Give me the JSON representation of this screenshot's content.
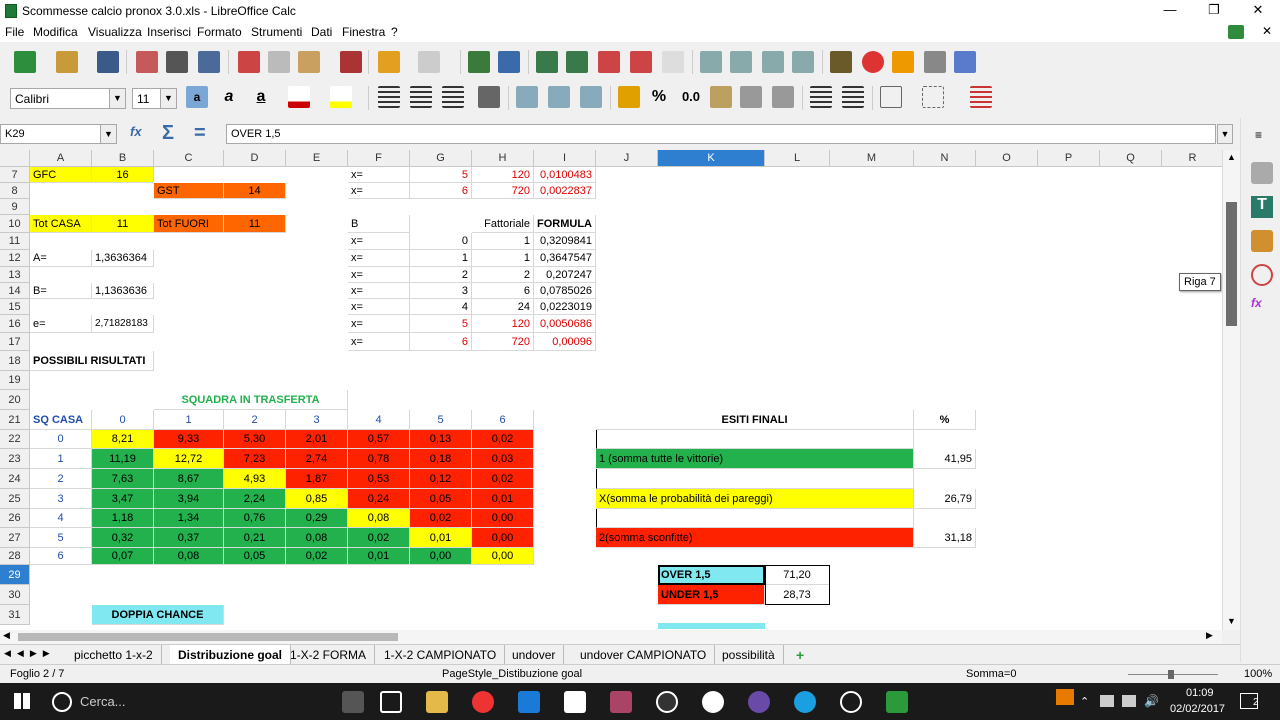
{
  "window": {
    "title": "Scommesse calcio pronox 3.0.xls - LibreOffice Calc"
  },
  "menu": [
    "File",
    "Modifica",
    "Visualizza",
    "Inserisci",
    "Formato",
    "Strumenti",
    "Dati",
    "Finestra",
    "?"
  ],
  "toolbar": {
    "font_name": "Calibri",
    "font_size": "11"
  },
  "formula_bar": {
    "name_box": "K29",
    "content": "OVER 1,5"
  },
  "columns": [
    "A",
    "B",
    "C",
    "D",
    "E",
    "F",
    "G",
    "H",
    "I",
    "J",
    "K",
    "L",
    "M",
    "N",
    "O",
    "P",
    "Q",
    "R"
  ],
  "selected_column": "K",
  "rows": [
    "7",
    "8",
    "9",
    "10",
    "11",
    "12",
    "13",
    "14",
    "15",
    "16",
    "17",
    "18",
    "19",
    "20",
    "21",
    "22",
    "23",
    "24",
    "25",
    "26",
    "27",
    "28",
    "29",
    "30",
    "31"
  ],
  "selected_row": "29",
  "cells": {
    "A7": "GFC",
    "B7": "16",
    "F7": "x=",
    "G7": "5",
    "H7": "120",
    "I7": "0,0100483",
    "C8": "GST",
    "D8": "14",
    "F8": "x=",
    "G8": "6",
    "H8": "720",
    "I8": "0,0022837",
    "A10": "Tot CASA",
    "B10": "11",
    "C10": "Tot FUORI",
    "D10": "11",
    "F10": "B",
    "H10": "Fattoriale",
    "I10": "FORMULA",
    "F11": "x=",
    "G11": "0",
    "H11": "1",
    "I11": "0,3209841",
    "A12": "A=",
    "B12": "1,3636364",
    "F12": "x=",
    "G12": "1",
    "H12": "1",
    "I12": "0,3647547",
    "F13": "x=",
    "G13": "2",
    "H13": "2",
    "I13": "0,207247",
    "A14": "B=",
    "B14": "1,1363636",
    "F14": "x=",
    "G14": "3",
    "H14": "6",
    "I14": "0,0785026",
    "F15": "x=",
    "G15": "4",
    "H15": "24",
    "I15": "0,0223019",
    "A16": "e=",
    "B16": "2,71828183",
    "F16": "x=",
    "G16": "5",
    "H16": "120",
    "I16": "0,0050686",
    "F17": "x=",
    "G17": "6",
    "H17": "720",
    "I17": "0,00096",
    "A18": "POSSIBILI RISULTATI",
    "C20": "SQUADRA IN TRASFERTA",
    "A21": "SQ CASA",
    "B21": "0",
    "C21": "1",
    "D21": "2",
    "E21": "3",
    "F21": "4",
    "G21": "5",
    "H21": "6",
    "K21": "ESITI FINALI",
    "N21": "%",
    "A22": "0",
    "B22": "8,21",
    "C22": "9,33",
    "D22": "5,30",
    "E22": "2,01",
    "F22": "0,57",
    "G22": "0,13",
    "H22": "0,02",
    "A23": "1",
    "B23": "11,19",
    "C23": "12,72",
    "D23": "7,23",
    "E23": "2,74",
    "F23": "0,78",
    "G23": "0,18",
    "H23": "0,03",
    "J23": "1 (somma tutte le vittorie)",
    "N23": "41,95",
    "A24": "2",
    "B24": "7,63",
    "C24": "8,67",
    "D24": "4,93",
    "E24": "1,87",
    "F24": "0,53",
    "G24": "0,12",
    "H24": "0,02",
    "A25": "3",
    "B25": "3,47",
    "C25": "3,94",
    "D25": "2,24",
    "E25": "0,85",
    "F25": "0,24",
    "G25": "0,05",
    "H25": "0,01",
    "J25": "X(somma le probabilità dei pareggi)",
    "N25": "26,79",
    "A26": "4",
    "B26": "1,18",
    "C26": "1,34",
    "D26": "0,76",
    "E26": "0,29",
    "F26": "0,08",
    "G26": "0,02",
    "H26": "0,00",
    "A27": "5",
    "B27": "0,32",
    "C27": "0,37",
    "D27": "0,21",
    "E27": "0,08",
    "F27": "0,02",
    "G27": "0,01",
    "H27": "0,00",
    "J27": "2(somma sconfitte)",
    "N27": "31,18",
    "A28": "6",
    "B28": "0,07",
    "C28": "0,08",
    "D28": "0,05",
    "E28": "0,02",
    "F28": "0,01",
    "G28": "0,00",
    "H28": "0,00",
    "K29": "OVER 1,5",
    "L29": "71,20",
    "K30": "UNDER 1,5",
    "L30": "28,73",
    "B31": "DOPPIA CHANCE"
  },
  "tooltip": "Riga 7",
  "sheet_tabs": [
    "picchetto 1-x-2",
    "Distribuzione goal",
    "1-X-2 FORMA",
    "1-X-2 CAMPIONATO",
    "undover",
    "undover CAMPIONATO",
    "possibilità"
  ],
  "active_tab": "Distribuzione goal",
  "status": {
    "sheet": "Foglio 2 / 7",
    "page_style": "PageStyle_Distibuzione goal",
    "sum": "Somma=0",
    "zoom": "100%"
  },
  "taskbar": {
    "search": "Cerca...",
    "time": "01:09",
    "date": "02/02/2017",
    "notifications": "2"
  },
  "colors": {
    "yellow": "#ffff00",
    "orange": "#ff6600",
    "green": "#22b14c",
    "red": "#ff2200",
    "cyan": "#7fe8f0",
    "selection": "#2f7fd0"
  }
}
